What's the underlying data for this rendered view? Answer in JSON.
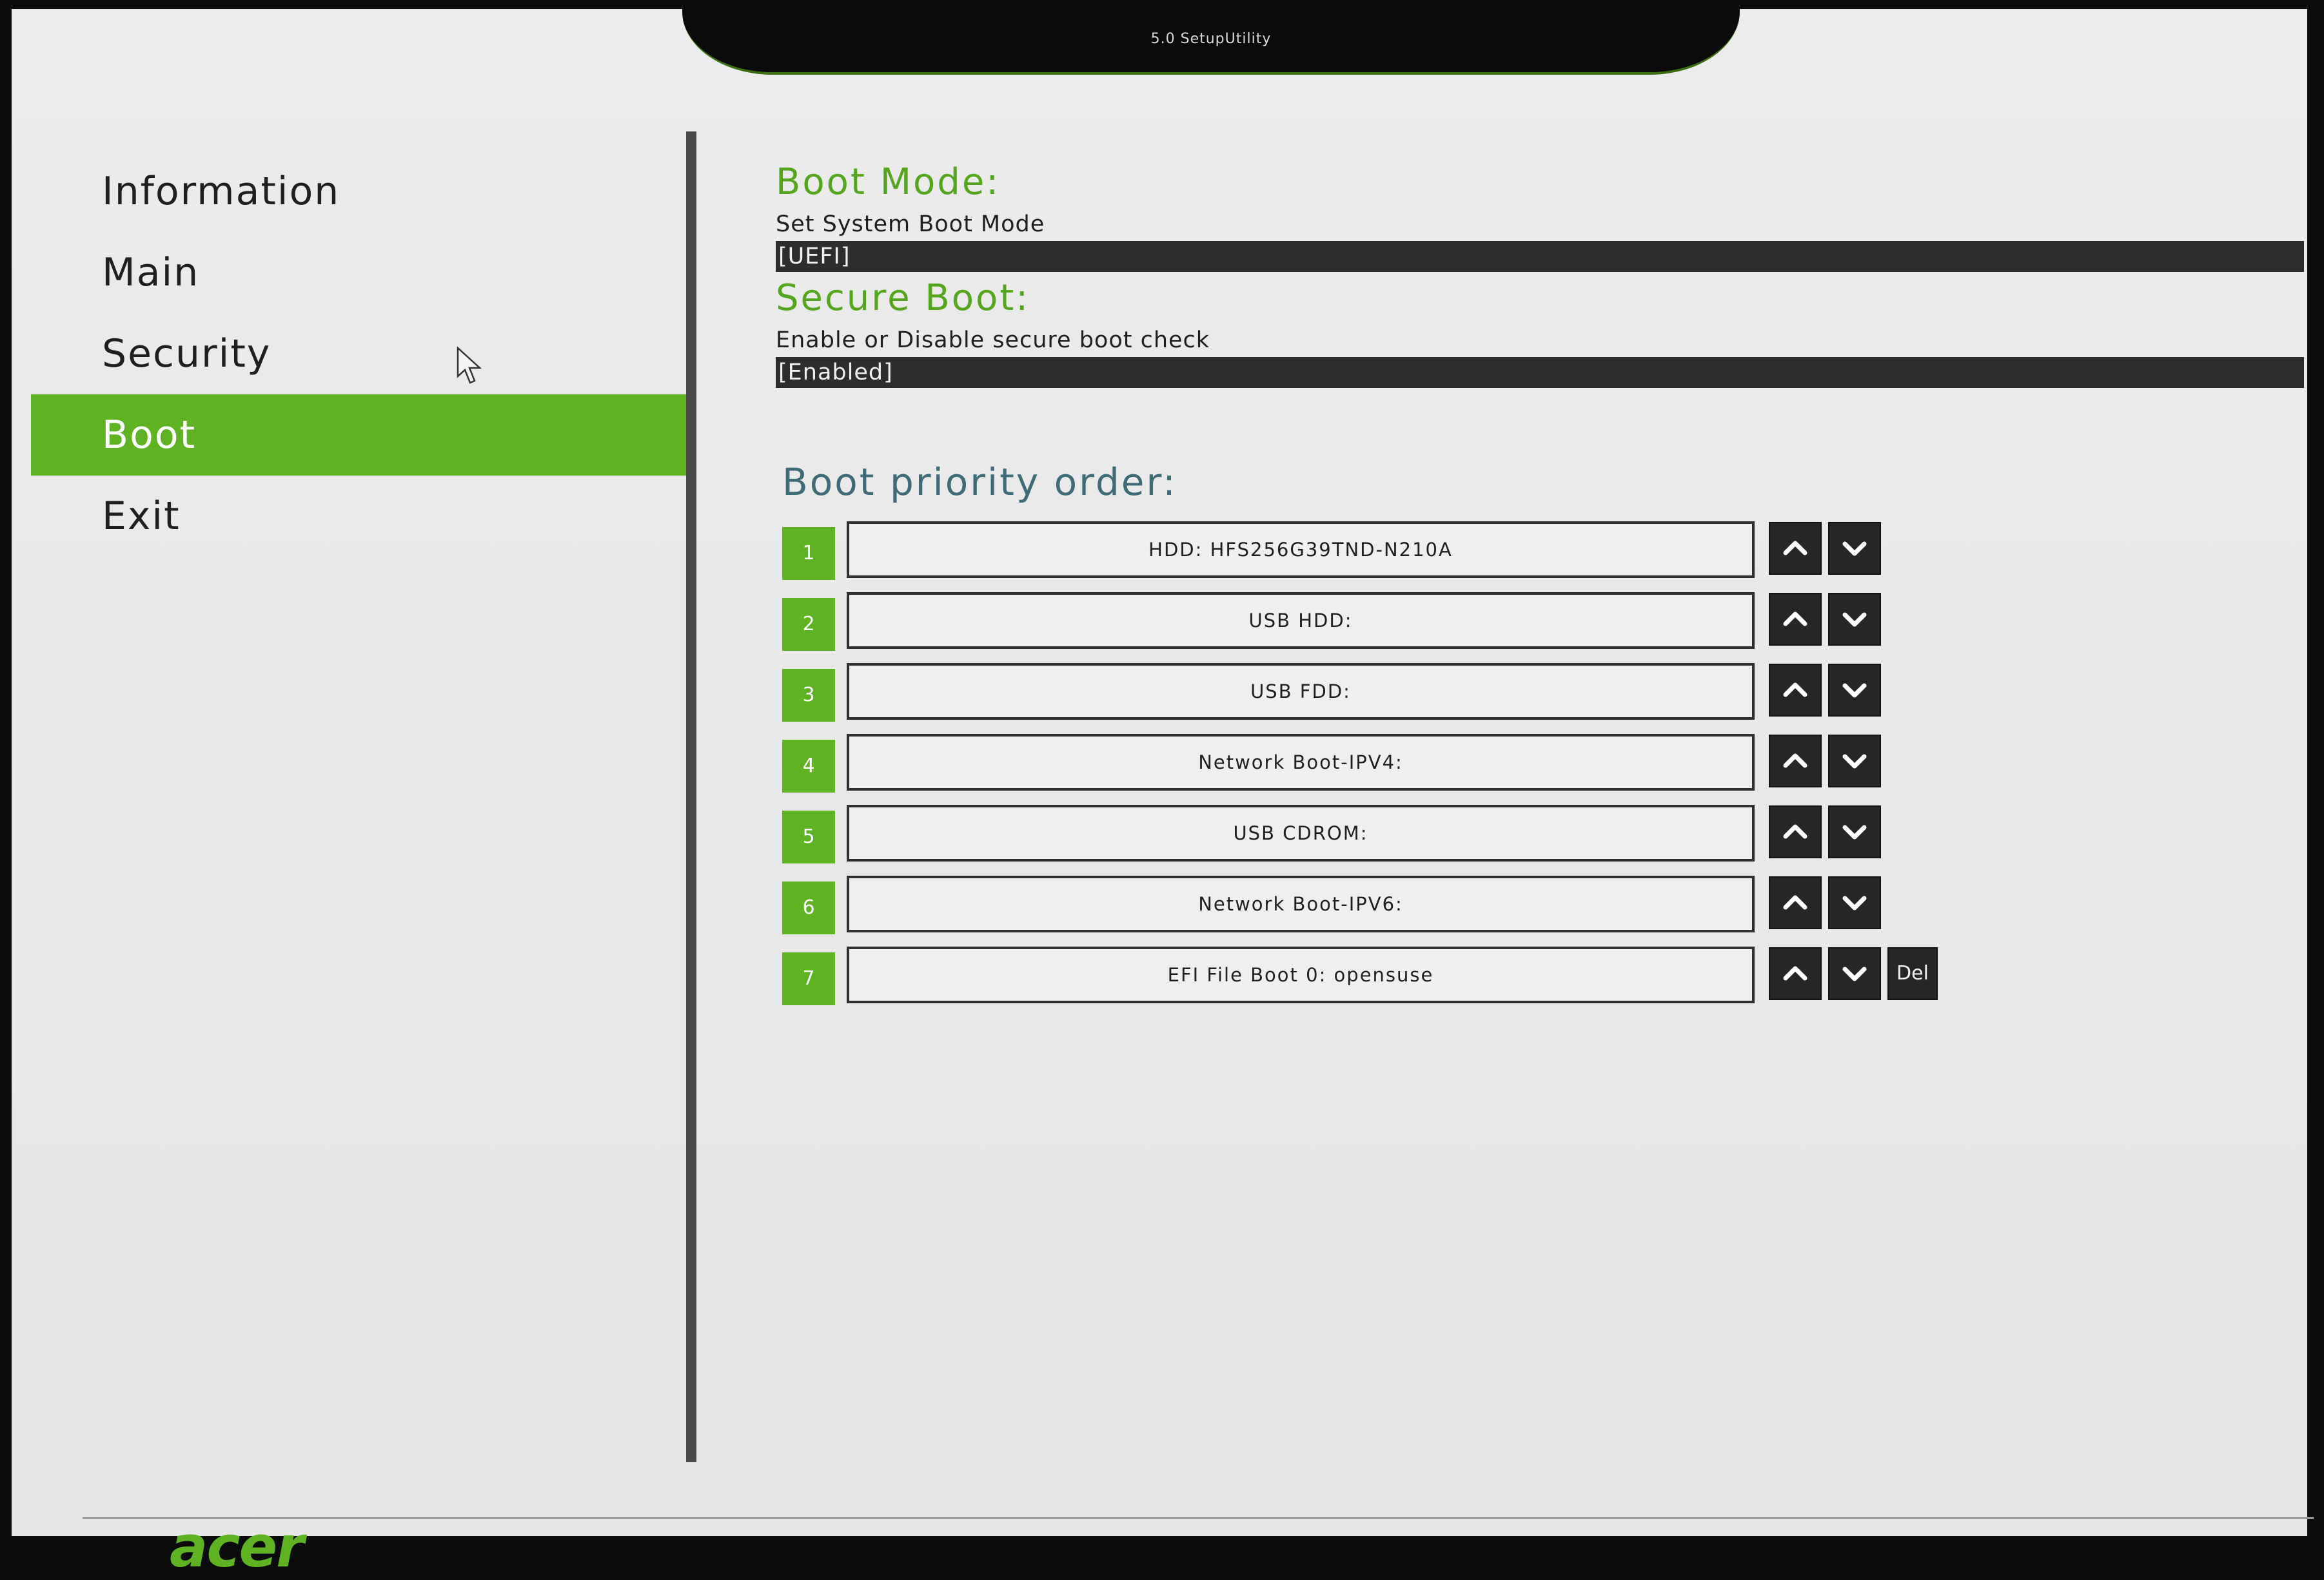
{
  "window": {
    "title": "5.0 SetupUtility"
  },
  "sidebar": {
    "items": [
      {
        "label": "Information",
        "active": false
      },
      {
        "label": "Main",
        "active": false
      },
      {
        "label": "Security",
        "active": false
      },
      {
        "label": "Boot",
        "active": true
      },
      {
        "label": "Exit",
        "active": false
      }
    ]
  },
  "boot_mode": {
    "title": "Boot Mode:",
    "description": "Set System Boot Mode",
    "value": "[UEFI]"
  },
  "secure_boot": {
    "title": "Secure Boot:",
    "description": "Enable or Disable secure boot check",
    "value": "[Enabled]"
  },
  "boot_priority": {
    "title": "Boot priority order:",
    "items": [
      {
        "num": "1",
        "device": "HDD: HFS256G39TND-N210A"
      },
      {
        "num": "2",
        "device": "USB HDD:"
      },
      {
        "num": "3",
        "device": "USB FDD:"
      },
      {
        "num": "4",
        "device": "Network Boot-IPV4:"
      },
      {
        "num": "5",
        "device": "USB CDROM:"
      },
      {
        "num": "6",
        "device": "Network Boot-IPV6:"
      },
      {
        "num": "7",
        "device": "EFI File Boot 0: opensuse"
      }
    ],
    "delete_label": "Del"
  },
  "footer": {
    "logo": "acer"
  },
  "colors": {
    "accent": "#5fb322",
    "section_title": "#55a51f",
    "priority_title": "#3f6b77",
    "value_bar": "#2d2d2d"
  },
  "icons": {
    "up": "chevron-up-icon",
    "down": "chevron-down-icon",
    "cursor": "mouse-pointer-icon"
  }
}
